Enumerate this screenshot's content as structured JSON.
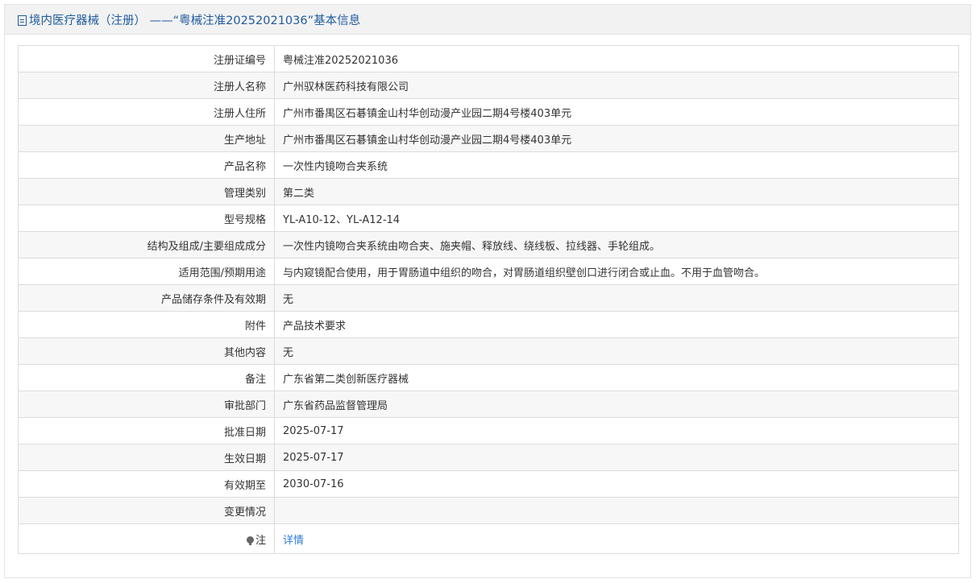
{
  "header": {
    "icon": "document-icon",
    "title": "境内医疗器械（注册） ——“粤械注准20252021036”基本信息"
  },
  "rows": [
    {
      "label": "注册证编号",
      "value": "粤械注准20252021036"
    },
    {
      "label": "注册人名称",
      "value": "广州驭林医药科技有限公司"
    },
    {
      "label": "注册人住所",
      "value": "广州市番禺区石碁镇金山村华创动漫产业园二期4号楼403单元"
    },
    {
      "label": "生产地址",
      "value": "广州市番禺区石碁镇金山村华创动漫产业园二期4号楼403单元"
    },
    {
      "label": "产品名称",
      "value": "一次性内镜吻合夹系统"
    },
    {
      "label": "管理类别",
      "value": "第二类"
    },
    {
      "label": "型号规格",
      "value": "YL-A10-12、YL-A12-14"
    },
    {
      "label": "结构及组成/主要组成成分",
      "value": "一次性内镜吻合夹系统由吻合夹、施夹帽、释放线、绕线板、拉线器、手轮组成。"
    },
    {
      "label": "适用范围/预期用途",
      "value": "与内窥镜配合使用，用于胃肠道中组织的吻合，对胃肠道组织壁创口进行闭合或止血。不用于血管吻合。"
    },
    {
      "label": "产品储存条件及有效期",
      "value": "无"
    },
    {
      "label": "附件",
      "value": "产品技术要求"
    },
    {
      "label": "其他内容",
      "value": "无"
    },
    {
      "label": "备注",
      "value": "广东省第二类创新医疗器械"
    },
    {
      "label": "审批部门",
      "value": "广东省药品监督管理局"
    },
    {
      "label": "批准日期",
      "value": "2025-07-17"
    },
    {
      "label": "生效日期",
      "value": "2025-07-17"
    },
    {
      "label": "有效期至",
      "value": "2030-07-16"
    },
    {
      "label": "变更情况",
      "value": ""
    }
  ],
  "note_row": {
    "icon": "lightbulb-icon",
    "label": "注",
    "link_text": "详情"
  },
  "colors": {
    "header_text": "#1f5b9e",
    "link": "#2d7bd3",
    "border": "#dcdcdc",
    "header_bg": "#f2f2f2"
  }
}
